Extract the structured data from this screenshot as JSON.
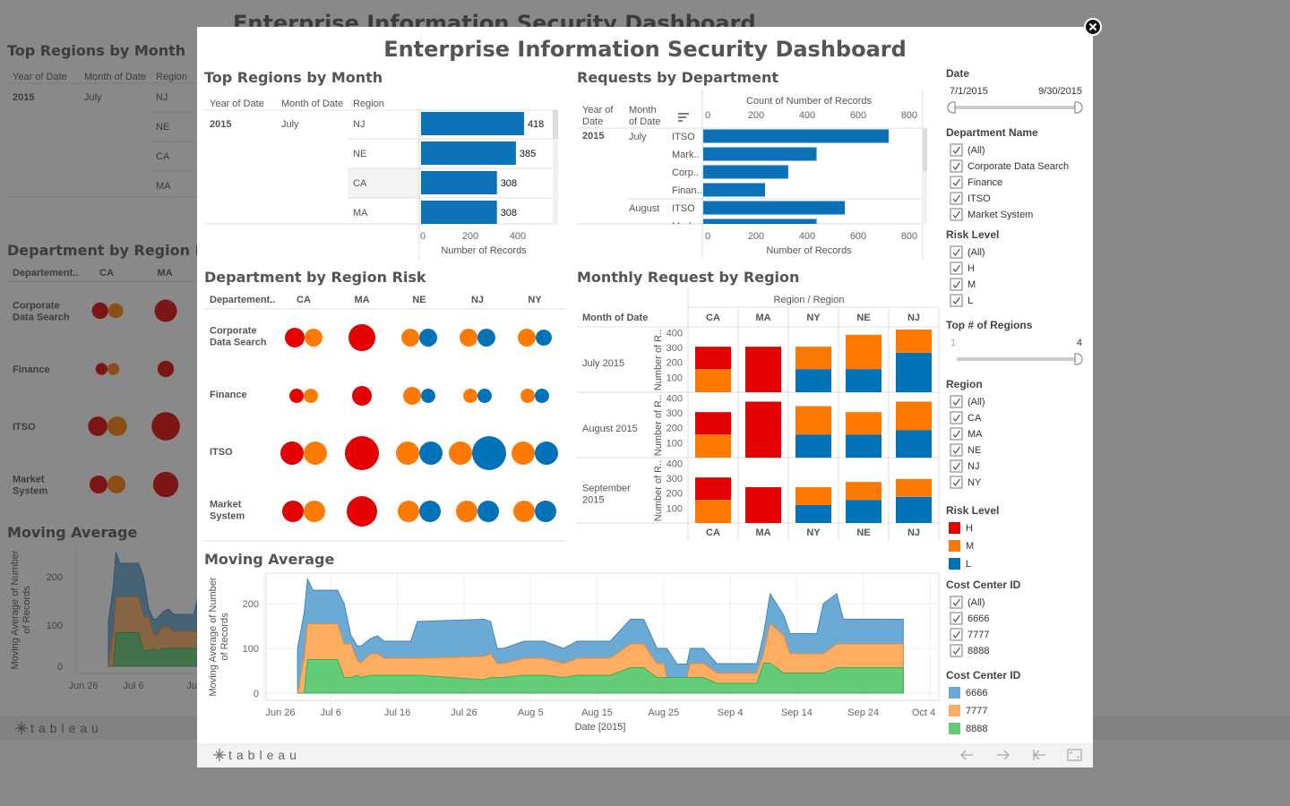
{
  "title": "Enterprise Information Security Dashboard",
  "colors": {
    "H": "#e30000",
    "M": "#ff7a00",
    "L": "#0072b8",
    "bar": "#0b72b8",
    "6666": "#6aaad4",
    "7777": "#ffad63",
    "8888": "#62cc78"
  },
  "background": {
    "title": "Enterprise Information Security Dashboard",
    "top_regions_title": "Top Regions by Month",
    "headers": [
      "Year of Date",
      "Month of Date",
      "Region"
    ],
    "year": "2015",
    "month": "July",
    "regions": [
      "NJ",
      "NE",
      "CA",
      "MA"
    ],
    "dept_title": "Department by Region Risk",
    "dept_headers": [
      "Departement..",
      "CA",
      "MA"
    ],
    "moving_title": "Moving Average",
    "moving_yticks": [
      "200",
      "100",
      "0"
    ],
    "moving_xticks": [
      "Jun 26",
      "Jul 6",
      "Ju"
    ],
    "moving_ylabel": [
      "Moving Average of Number",
      "of Records"
    ]
  },
  "chart_data": [
    {
      "type": "bar",
      "title": "Top Regions by Month",
      "headers": [
        "Year of Date",
        "Month of Date",
        "Region"
      ],
      "year": "2015",
      "month": "July",
      "categories": [
        "NJ",
        "NE",
        "CA",
        "MA"
      ],
      "values": [
        418,
        385,
        308,
        308
      ],
      "xticks": [
        0,
        200,
        400
      ],
      "xlabel": "Number of Records"
    },
    {
      "type": "bar",
      "title": "Requests by Department",
      "headers": [
        [
          "Year of",
          "Date"
        ],
        [
          "Month",
          "of Date"
        ]
      ],
      "top_axis_label": "Count of Number of Records",
      "xlabel": "Number of Records",
      "xticks": [
        0,
        200,
        400,
        600,
        800
      ],
      "xlim": [
        0,
        800
      ],
      "year": "2015",
      "rows": [
        {
          "month": "July",
          "dept": "ITSO",
          "value": 720
        },
        {
          "month": "",
          "dept": "Mark..",
          "value": 440
        },
        {
          "month": "",
          "dept": "Corp..",
          "value": 330
        },
        {
          "month": "",
          "dept": "Finan..",
          "value": 240
        },
        {
          "month": "August",
          "dept": "ITSO",
          "value": 550
        },
        {
          "month": "",
          "dept": "Mark..",
          "value": 440
        }
      ]
    },
    {
      "type": "scatter",
      "title": "Department by Region Risk",
      "row_header": "Departement..",
      "columns": [
        "CA",
        "MA",
        "NE",
        "NJ",
        "NY"
      ],
      "rows": [
        {
          "label": [
            "Corporate",
            "Data Search"
          ],
          "cells": [
            {
              "H": 84,
              "M": 69
            },
            {
              "H": 156
            },
            {
              "M": 69,
              "L": 69
            },
            {
              "M": 69,
              "L": 69
            },
            {
              "M": 69,
              "L": 56
            }
          ]
        },
        {
          "label": [
            "Finance"
          ],
          "cells": [
            {
              "H": 44,
              "M": 44
            },
            {
              "H": 84
            },
            {
              "M": 69,
              "L": 44
            },
            {
              "M": 44,
              "L": 44
            },
            {
              "M": 44,
              "L": 44
            }
          ]
        },
        {
          "label": [
            "ITSO"
          ],
          "cells": [
            {
              "H": 117,
              "M": 117
            },
            {
              "H": 250
            },
            {
              "M": 117,
              "L": 117
            },
            {
              "M": 117,
              "L": 250
            },
            {
              "M": 117,
              "L": 117
            }
          ]
        },
        {
          "label": [
            "Market",
            "System"
          ],
          "cells": [
            {
              "H": 100,
              "M": 100
            },
            {
              "H": 200
            },
            {
              "M": 100,
              "L": 100
            },
            {
              "M": 100,
              "L": 100
            },
            {
              "M": 100,
              "L": 100
            }
          ]
        }
      ]
    },
    {
      "type": "bar",
      "stacked": true,
      "title": "Monthly Request by Region",
      "column_header": "Region  /  Region",
      "row_header": "Month of Date",
      "ylabel": "Number of R..",
      "yticks": [
        100,
        200,
        300,
        400
      ],
      "ylim": [
        0,
        420
      ],
      "regions": [
        "CA",
        "MA",
        "NY",
        "NE",
        "NJ"
      ],
      "months": [
        {
          "label": [
            "July 2015"
          ],
          "values": [
            {
              "L": 0,
              "M": 155,
              "H": 150
            },
            {
              "L": 0,
              "M": 0,
              "H": 305
            },
            {
              "L": 155,
              "M": 150,
              "H": 0
            },
            {
              "L": 155,
              "M": 230,
              "H": 0
            },
            {
              "L": 265,
              "M": 155,
              "H": 0
            }
          ]
        },
        {
          "label": [
            "August 2015"
          ],
          "values": [
            {
              "L": 0,
              "M": 155,
              "H": 150
            },
            {
              "L": 0,
              "M": 0,
              "H": 375
            },
            {
              "L": 155,
              "M": 190,
              "H": 0
            },
            {
              "L": 155,
              "M": 150,
              "H": 0
            },
            {
              "L": 185,
              "M": 190,
              "H": 0
            }
          ]
        },
        {
          "label": [
            "September",
            "2015"
          ],
          "values": [
            {
              "L": 0,
              "M": 155,
              "H": 150
            },
            {
              "L": 0,
              "M": 0,
              "H": 240
            },
            {
              "L": 120,
              "M": 120,
              "H": 0
            },
            {
              "L": 155,
              "M": 120,
              "H": 0
            },
            {
              "L": 175,
              "M": 120,
              "H": 0
            }
          ]
        }
      ]
    },
    {
      "type": "area",
      "stacked": true,
      "title": "Moving Average",
      "ylabel": [
        "Moving Average of Number",
        "of Records"
      ],
      "xlabel": "Date [2015]",
      "x_unit": "days since Jun 26, 2015",
      "yticks": [
        0,
        100,
        200
      ],
      "xticks": [
        {
          "day": 0,
          "label": "Jun 26"
        },
        {
          "day": 10,
          "label": "Jul 6"
        },
        {
          "day": 20,
          "label": "Jul 16"
        },
        {
          "day": 30,
          "label": "Jul 26"
        },
        {
          "day": 40,
          "label": "Aug 5"
        },
        {
          "day": 50,
          "label": "Aug 15"
        },
        {
          "day": 60,
          "label": "Aug 25"
        },
        {
          "day": 70,
          "label": "Sep 4"
        },
        {
          "day": 80,
          "label": "Sep 14"
        },
        {
          "day": 90,
          "label": "Sep 24"
        },
        {
          "day": 100,
          "label": "Oct 4"
        }
      ],
      "x": [
        5,
        6,
        6.5,
        7.3,
        11,
        12,
        13,
        14,
        14.5,
        16,
        17,
        18,
        22,
        23,
        33,
        34,
        35,
        36,
        39,
        42,
        45,
        47,
        52,
        55,
        57,
        59,
        60,
        60.5,
        62,
        63.5,
        64,
        66,
        68,
        74,
        75,
        76,
        78,
        79,
        83,
        84,
        86,
        87,
        96
      ],
      "series": [
        {
          "name": "8888",
          "values": [
            0,
            0,
            75,
            75,
            75,
            35,
            35,
            40,
            35,
            40,
            40,
            40,
            40,
            40,
            30,
            35,
            35,
            35,
            40,
            40,
            35,
            40,
            40,
            57,
            57,
            35,
            35,
            35,
            35,
            35,
            35,
            35,
            22,
            22,
            67,
            67,
            45,
            45,
            45,
            45,
            57,
            57,
            57
          ]
        },
        {
          "name": "7777",
          "values": [
            0,
            80,
            80,
            80,
            80,
            75,
            75,
            32,
            33,
            48,
            48,
            38,
            38,
            38,
            52,
            53,
            31,
            31,
            38,
            38,
            31,
            38,
            38,
            53,
            53,
            31,
            31,
            0,
            0,
            0,
            31,
            31,
            23,
            23,
            21,
            88,
            85,
            43,
            43,
            43,
            53,
            53,
            53
          ]
        },
        {
          "name": "6666",
          "values": [
            100,
            100,
            100,
            75,
            75,
            90,
            20,
            33,
            37,
            34,
            40,
            38,
            38,
            82,
            83,
            72,
            34,
            34,
            38,
            38,
            34,
            38,
            38,
            55,
            55,
            34,
            34,
            65,
            30,
            30,
            34,
            34,
            21,
            21,
            42,
            67,
            45,
            45,
            45,
            112,
            112,
            55,
            55
          ]
        }
      ]
    }
  ],
  "filters": {
    "date": {
      "title": "Date",
      "start": "7/1/2015",
      "end": "9/30/2015"
    },
    "department": {
      "title": "Department Name",
      "items": [
        "(All)",
        "Corporate Data Search",
        "Finance",
        "ITSO",
        "Market System"
      ]
    },
    "risk": {
      "title": "Risk Level",
      "items": [
        "(All)",
        "H",
        "M",
        "L"
      ]
    },
    "top_regions": {
      "title": "Top # of Regions",
      "min": "1",
      "max": "4",
      "value": 4
    },
    "region": {
      "title": "Region",
      "items": [
        "(All)",
        "CA",
        "MA",
        "NE",
        "NJ",
        "NY"
      ]
    },
    "risk_legend": {
      "title": "Risk Level",
      "items": [
        {
          "label": "H",
          "key": "H"
        },
        {
          "label": "M",
          "key": "M"
        },
        {
          "label": "L",
          "key": "L"
        }
      ]
    },
    "cost_center": {
      "title": "Cost Center ID",
      "items": [
        "(All)",
        "6666",
        "7777",
        "8888"
      ]
    },
    "cost_legend": {
      "title": "Cost Center ID",
      "items": [
        {
          "label": "6666",
          "key": "6666"
        },
        {
          "label": "7777",
          "key": "7777"
        },
        {
          "label": "8888",
          "key": "8888"
        }
      ]
    }
  },
  "footer": {
    "logo": "tableau"
  }
}
